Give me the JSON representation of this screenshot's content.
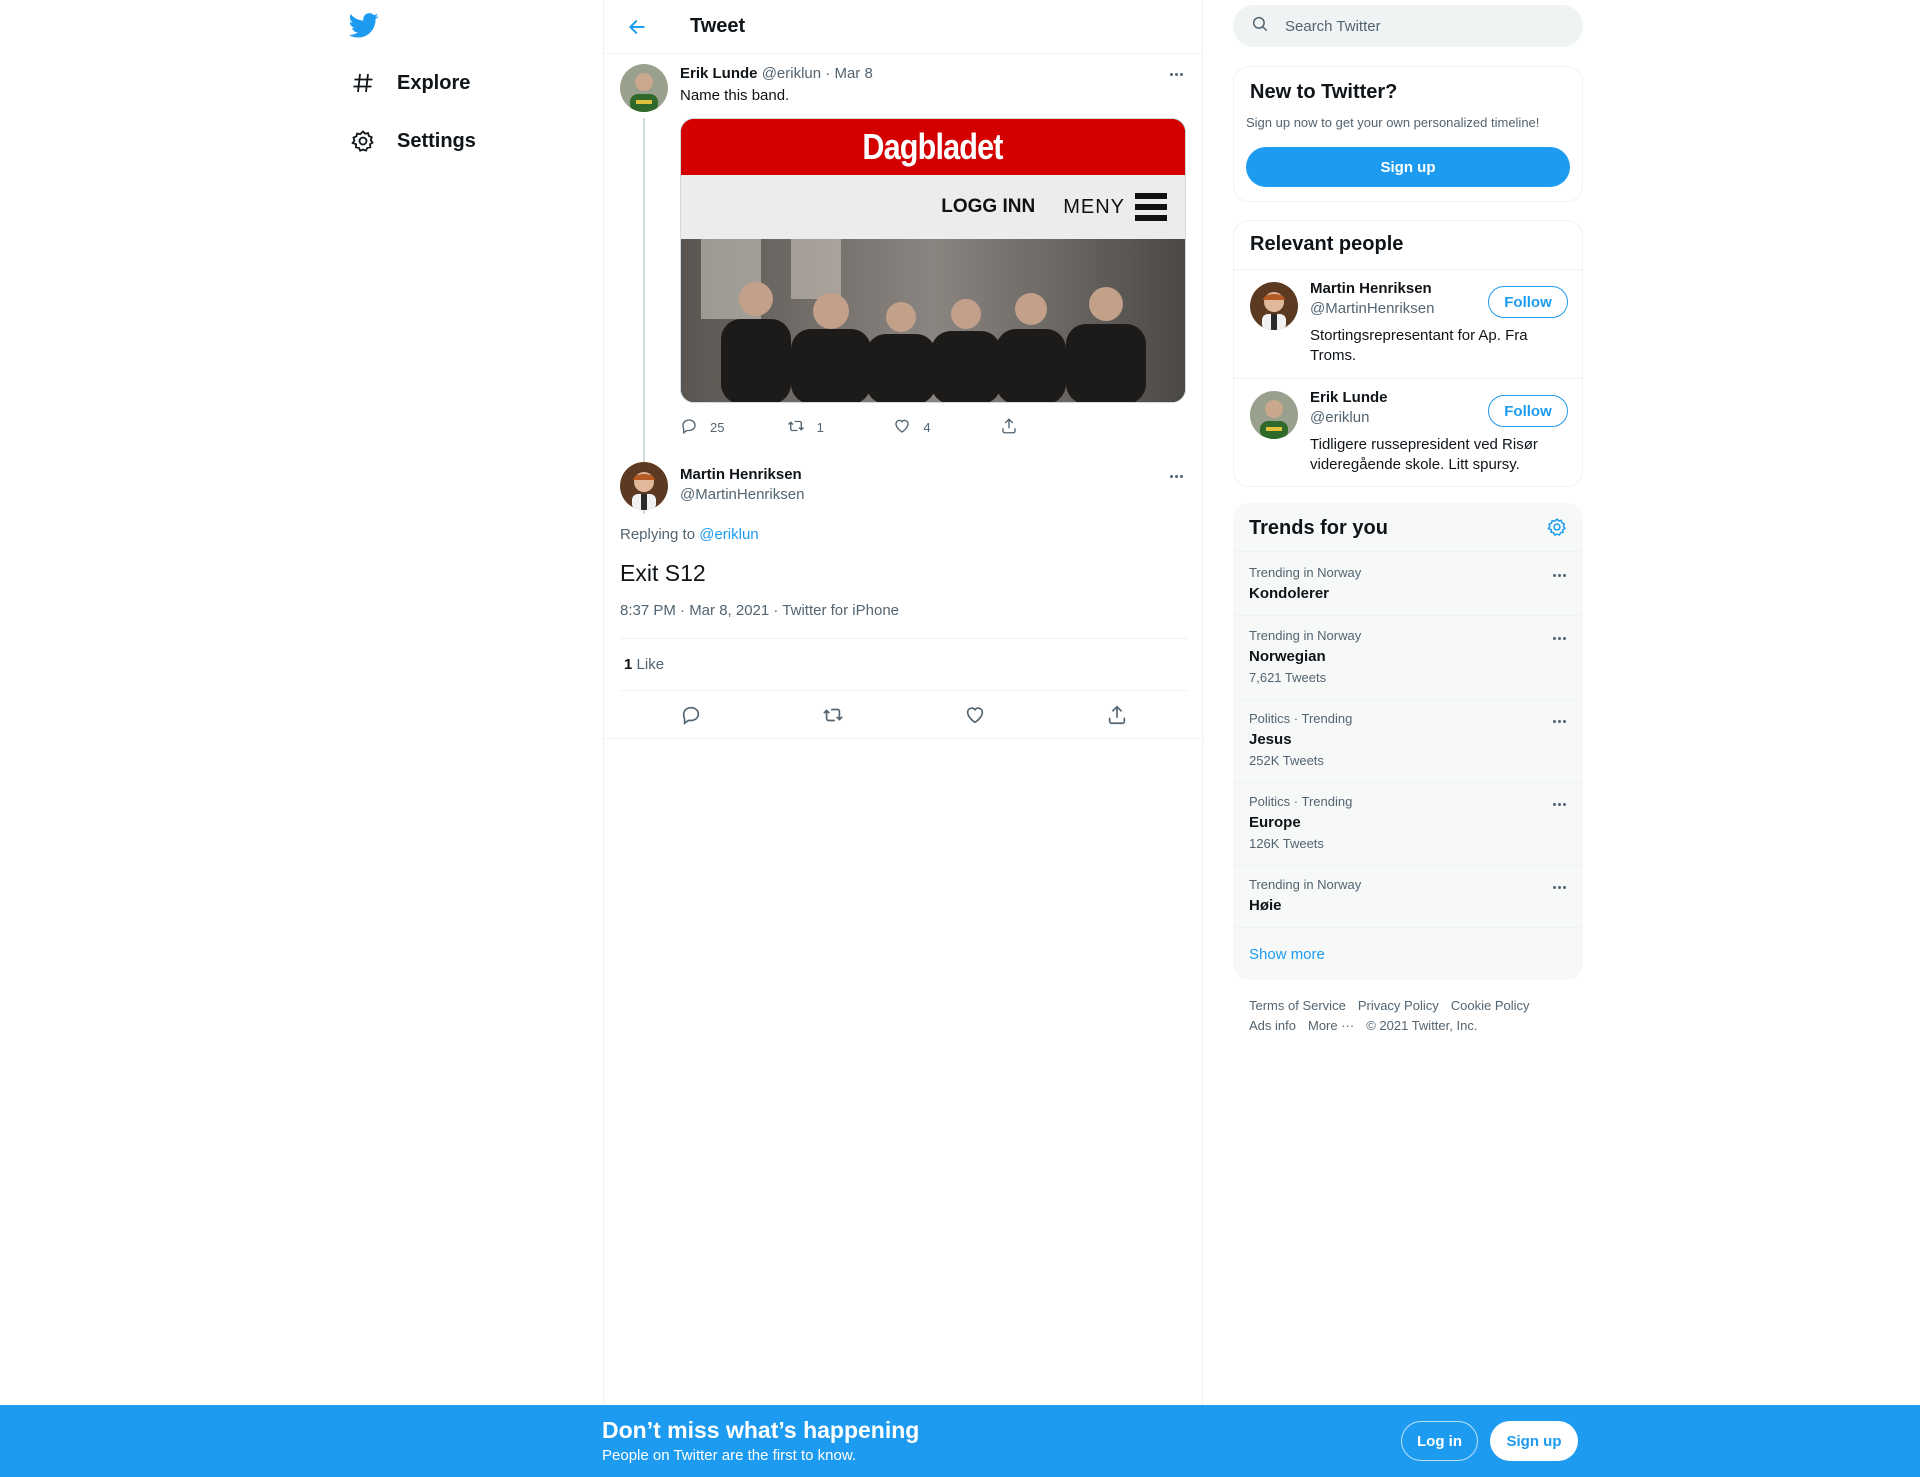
{
  "nav": {
    "logo_icon": "twitter-bird-icon",
    "items": [
      {
        "label": "Explore",
        "icon": "hashtag-icon"
      },
      {
        "label": "Settings",
        "icon": "gear-icon"
      }
    ]
  },
  "header": {
    "title": "Tweet",
    "back_icon": "back-arrow-icon"
  },
  "parent_tweet": {
    "name": "Erik Lunde",
    "handle": "@eriklun",
    "date": "Mar 8",
    "text": "Name this band.",
    "media": {
      "masthead": "Dagbladet",
      "login": "LOGG INN",
      "menu": "MENY"
    },
    "replies": "25",
    "retweets": "1",
    "likes": "4"
  },
  "main_tweet": {
    "name": "Martin Henriksen",
    "handle": "@MartinHenriksen",
    "replying_prefix": "Replying to",
    "replying_to": "@eriklun",
    "text": "Exit S12",
    "timestamp": "8:37 PM · Mar 8, 2021 · Twitter for iPhone",
    "like_count": "1",
    "like_label": "Like"
  },
  "search": {
    "placeholder": "Search Twitter"
  },
  "new_to_twitter": {
    "title": "New to Twitter?",
    "subtitle": "Sign up now to get your own personalized timeline!",
    "button": "Sign up"
  },
  "relevant_people": {
    "title": "Relevant people",
    "people": [
      {
        "name": "Martin Henriksen",
        "handle": "@MartinHenriksen",
        "bio": "Stortingsrepresentant for Ap. Fra Troms.",
        "follow": "Follow"
      },
      {
        "name": "Erik Lunde",
        "handle": "@eriklun",
        "bio": "Tidligere russepresident ved Risør videregående skole. Litt spursy.",
        "follow": "Follow"
      }
    ]
  },
  "trends": {
    "title": "Trends for you",
    "items": [
      {
        "context": "Trending in Norway",
        "name": "Kondolerer",
        "count": ""
      },
      {
        "context": "Trending in Norway",
        "name": "Norwegian",
        "count": "7,621 Tweets"
      },
      {
        "context": "Politics · Trending",
        "name": "Jesus",
        "count": "252K Tweets"
      },
      {
        "context": "Politics · Trending",
        "name": "Europe",
        "count": "126K Tweets"
      },
      {
        "context": "Trending in Norway",
        "name": "Høie",
        "count": ""
      }
    ],
    "show_more": "Show more"
  },
  "footer": {
    "links": [
      "Terms of Service",
      "Privacy Policy",
      "Cookie Policy",
      "Ads info",
      "More ···"
    ],
    "copyright": "© 2021 Twitter, Inc."
  },
  "bottom_bar": {
    "title": "Don’t miss what’s happening",
    "subtitle": "People on Twitter are the first to know.",
    "login": "Log in",
    "signup": "Sign up"
  },
  "colors": {
    "accent": "#1d9bf0",
    "muted": "#536471",
    "text": "#0f1419"
  }
}
